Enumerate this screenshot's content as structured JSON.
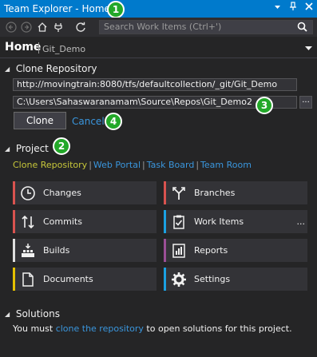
{
  "window": {
    "title": "Team Explorer - Home",
    "controls": [
      "dropdown-arrow",
      "pin",
      "close"
    ]
  },
  "toolbar": {
    "buttons": [
      "back-icon",
      "forward-icon",
      "home-icon",
      "connect-icon",
      "refresh-icon"
    ],
    "search_placeholder": "Search Work Items (Ctrl+')"
  },
  "page": {
    "title": "Home",
    "subtitle": "Git_Demo"
  },
  "clone_section": {
    "header": "Clone Repository",
    "url_value": "http://movingtrain:8080/tfs/defaultcollection/_git/Git_Demo",
    "path_value": "C:\\Users\\Sahaswaranamam\\Source\\Repos\\Git_Demo2",
    "browse_label": "...",
    "clone_label": "Clone",
    "cancel_label": "Cancel"
  },
  "project_section": {
    "header": "Project",
    "links": [
      "Clone Repository",
      "Web Portal",
      "Task Board",
      "Team Room"
    ],
    "link_separator": "|",
    "tiles": [
      {
        "label": "Changes",
        "icon": "clock-icon",
        "color": "#d9534f"
      },
      {
        "label": "Branches",
        "icon": "branch-icon",
        "color": "#d9534f"
      },
      {
        "label": "Commits",
        "icon": "sync-arrows-icon",
        "color": "#d9534f"
      },
      {
        "label": "Work Items",
        "icon": "clipboard-check-icon",
        "color": "#1ba1e2",
        "more": "..."
      },
      {
        "label": "Builds",
        "icon": "build-icon",
        "color": "#e0e0e0"
      },
      {
        "label": "Reports",
        "icon": "report-icon",
        "color": "#9b4f96"
      },
      {
        "label": "Documents",
        "icon": "document-icon",
        "color": "#e5c100"
      },
      {
        "label": "Settings",
        "icon": "gear-icon",
        "color": "#1ba1e2"
      }
    ]
  },
  "solutions_section": {
    "header": "Solutions",
    "text_before": "You must ",
    "link": "clone the repository",
    "text_after": " to open solutions for this project."
  },
  "callouts": [
    "1",
    "2",
    "3",
    "4"
  ],
  "colors": {
    "title_bar": "#007acc",
    "background": "#252526",
    "tile_background": "#333337",
    "link": "#3a96dd",
    "active_link": "#c7c73a",
    "callout": "#23a829"
  }
}
